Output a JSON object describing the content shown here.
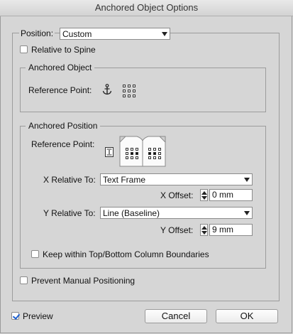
{
  "window": {
    "title": "Anchored Object Options"
  },
  "position": {
    "label": "Position:",
    "value": "Custom"
  },
  "relative_to_spine": {
    "label": "Relative to Spine",
    "checked": false
  },
  "anchored_object": {
    "legend": "Anchored Object",
    "reference_point_label": "Reference Point:"
  },
  "anchored_position": {
    "legend": "Anchored Position",
    "reference_point_label": "Reference Point:",
    "x_relative_label": "X Relative To:",
    "x_relative_value": "Text Frame",
    "x_offset_label": "X Offset:",
    "x_offset_value": "0 mm",
    "y_relative_label": "Y Relative To:",
    "y_relative_value": "Line (Baseline)",
    "y_offset_label": "Y Offset:",
    "y_offset_value": "9 mm",
    "keep_within_label": "Keep within Top/Bottom Column Boundaries",
    "keep_within_checked": false
  },
  "prevent_manual": {
    "label": "Prevent Manual Positioning",
    "checked": false
  },
  "preview": {
    "label": "Preview",
    "checked": true
  },
  "buttons": {
    "cancel": "Cancel",
    "ok": "OK"
  },
  "colors": {
    "accent": "#1c5fd1",
    "background": "#d6d6d6"
  },
  "icons": {
    "anchor": "anchor-icon",
    "split_y": "split-y-icon",
    "reference_grid": "reference-point-grid-icon"
  }
}
